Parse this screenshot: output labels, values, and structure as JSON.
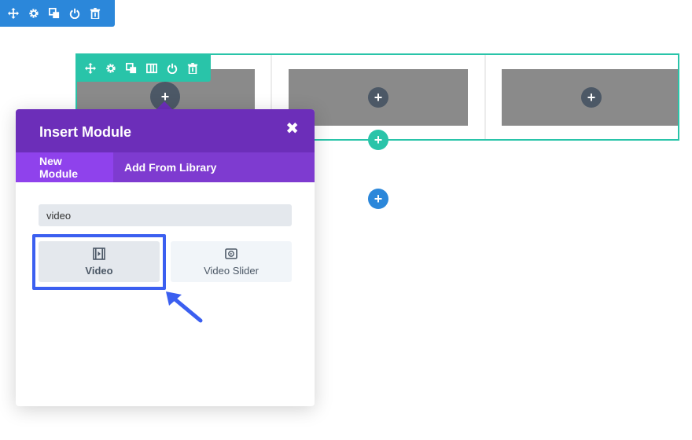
{
  "colors": {
    "section": "#2b87da",
    "row": "#29c4a9",
    "modal_header": "#6c2eb9",
    "modal_tabs": "#7e3bd0",
    "active_tab": "#8f42ec",
    "highlight": "#3b5ff0"
  },
  "section_toolbar": {
    "icons": [
      "move-icon",
      "gear-icon",
      "duplicate-icon",
      "power-icon",
      "trash-icon"
    ]
  },
  "row_toolbar": {
    "icons": [
      "move-icon",
      "gear-icon",
      "duplicate-icon",
      "columns-icon",
      "power-icon",
      "trash-icon"
    ]
  },
  "buttons": {
    "add_module": "+",
    "add_row": "+",
    "add_section": "+"
  },
  "modal": {
    "title": "Insert Module",
    "close": "✖",
    "tabs": [
      {
        "label": "New Module",
        "active": true
      },
      {
        "label": "Add From Library",
        "active": false
      }
    ],
    "search": {
      "value": "video"
    },
    "modules": [
      {
        "label": "Video",
        "icon": "video-icon",
        "selected": true
      },
      {
        "label": "Video Slider",
        "icon": "video-slider-icon",
        "selected": false
      }
    ]
  }
}
